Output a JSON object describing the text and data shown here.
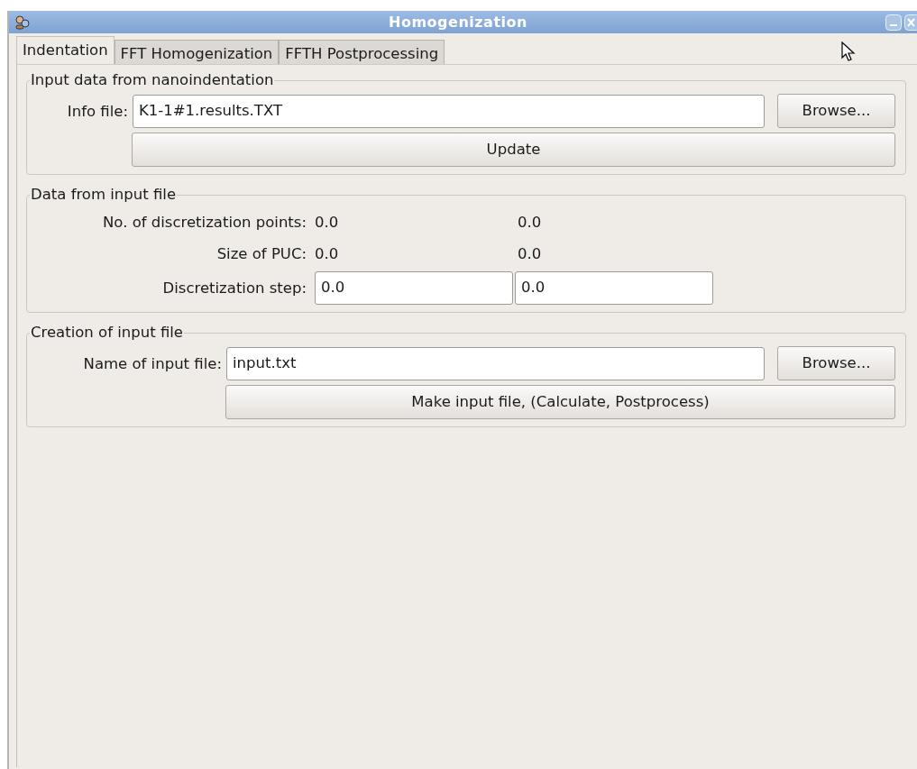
{
  "window": {
    "title": "Homogenization"
  },
  "tabs": [
    {
      "label": "Indentation",
      "selected": true
    },
    {
      "label": "FFT Homogenization",
      "selected": false
    },
    {
      "label": "FFTH Postprocessing",
      "selected": false
    }
  ],
  "input_data": {
    "title": "Input data from nanoindentation",
    "info_file": {
      "label": "Info file:",
      "value": "K1-1#1.results.TXT"
    },
    "browse_button": "Browse...",
    "update_button": "Update"
  },
  "data_from_file": {
    "title": "Data from input file",
    "discretization_points": {
      "label": "No. of discretization points:",
      "values": [
        "0.0",
        "0.0"
      ]
    },
    "size_of_puc": {
      "label": "Size of PUC:",
      "values": [
        "0.0",
        "0.0"
      ]
    },
    "discretization_step": {
      "label": "Discretization step:",
      "fields": [
        "0.0",
        "0.0"
      ]
    }
  },
  "creation": {
    "title": "Creation of input file",
    "input_file": {
      "label": "Name of input file:",
      "value": "input.txt"
    },
    "browse_button": "Browse...",
    "make_button": "Make input file, (Calculate, Postprocess)"
  }
}
